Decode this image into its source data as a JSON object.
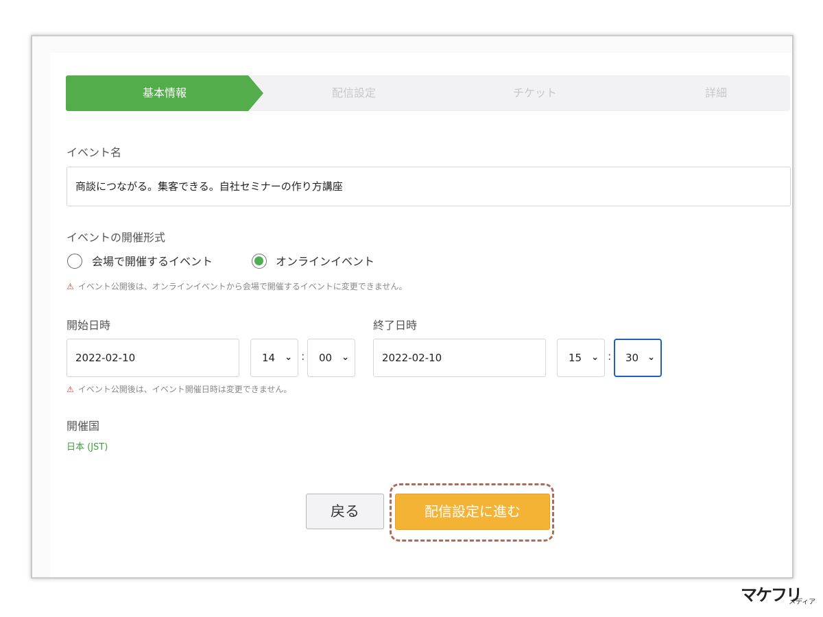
{
  "steps": [
    "基本情報",
    "配信設定",
    "チケット",
    "詳細"
  ],
  "event_name": {
    "label": "イベント名",
    "value": "商談につながる。集客できる。自社セミナーの作り方講座"
  },
  "format": {
    "label": "イベントの開催形式",
    "options": [
      "会場で開催するイベント",
      "オンラインイベント"
    ],
    "selected": "オンラインイベント",
    "warning": "イベント公開後は、オンラインイベントから会場で開催するイベントに変更できません。"
  },
  "start": {
    "label": "開始日時",
    "date": "2022-02-10",
    "hour": "14",
    "minute": "00"
  },
  "end": {
    "label": "終了日時",
    "date": "2022-02-10",
    "hour": "15",
    "minute": "30"
  },
  "time_separator": ":",
  "datetime_warning": "イベント公開後は、イベント開催日時は変更できません。",
  "country": {
    "label": "開催国",
    "value": "日本 (JST)"
  },
  "buttons": {
    "back": "戻る",
    "next": "配信設定に進む"
  },
  "warning_icon": "⚠",
  "chevron_icon": "⌄",
  "logo": {
    "main": "マケフリ",
    "sub": "メディア"
  },
  "colors": {
    "accent_green": "#52ad4a",
    "next_button": "#f5b335",
    "focus_border": "#1f5fb8",
    "warning": "#d43a2f"
  }
}
